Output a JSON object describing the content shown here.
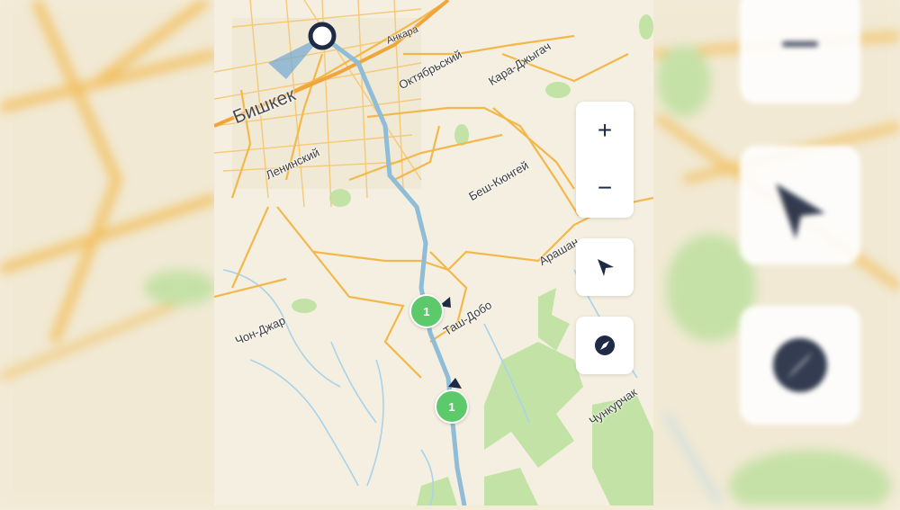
{
  "map": {
    "labels": {
      "bishkek": "Бишкек",
      "leninsky": "Ленинский",
      "oktyabrsky": "Октябрьский",
      "ankara": "Анкара",
      "kara_dzhygach": "Кара-Джыгач",
      "besh_kyungei": "Беш-Кюнгей",
      "arashan": "Арашан",
      "tash_dobo": "Таш-Добо",
      "chon_dzhar": "Чон-Джар",
      "chunkurchak": "Чункурчак"
    },
    "markers": [
      {
        "label": "1"
      },
      {
        "label": "1"
      }
    ],
    "colors": {
      "road": "#f2b84b",
      "route": "#8fbcd6",
      "park": "#bfe0a0",
      "water": "#a9d3ea",
      "marker": "#5cc96a",
      "start": "#1f2a44"
    }
  },
  "controls": {
    "zoom_in": "+",
    "zoom_out": "−",
    "locate_icon": "navigation-arrow-icon",
    "compass_icon": "compass-icon"
  }
}
